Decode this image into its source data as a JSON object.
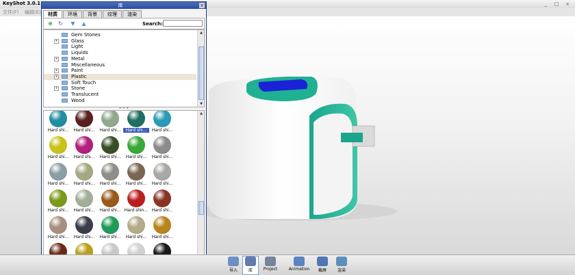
{
  "app": {
    "title": "KeyShot 3.0.1",
    "menu": [
      "文件(F)",
      "编辑(E)"
    ],
    "window_controls": [
      "_",
      "□",
      "×"
    ]
  },
  "library": {
    "title": "库",
    "tabs": [
      "材质",
      "环境",
      "背景",
      "纹理",
      "渲染"
    ],
    "active_tab": 0,
    "search_label": "Search:",
    "search_value": "",
    "toolbar_icons": [
      "add-material-icon",
      "refresh-icon",
      "move-down-icon",
      "move-up-icon"
    ],
    "tree": [
      {
        "label": "Gem Stones",
        "expandable": false
      },
      {
        "label": "Glass",
        "expandable": true
      },
      {
        "label": "Light",
        "expandable": false
      },
      {
        "label": "Liquids",
        "expandable": false
      },
      {
        "label": "Metal",
        "expandable": true
      },
      {
        "label": "Miscellaneous",
        "expandable": false
      },
      {
        "label": "Paint",
        "expandable": true
      },
      {
        "label": "Plastic",
        "expandable": true,
        "selected": true
      },
      {
        "label": "Soft Touch",
        "expandable": false
      },
      {
        "label": "Stone",
        "expandable": true
      },
      {
        "label": "Translucent",
        "expandable": false
      },
      {
        "label": "Wood",
        "expandable": false
      }
    ],
    "materials": [
      {
        "label": "Hard shi...",
        "color": "#1f8ea0"
      },
      {
        "label": "Hard shi...",
        "color": "#5a2020"
      },
      {
        "label": "Hard shi...",
        "color": "#8fa88e"
      },
      {
        "label": "Hard shi...",
        "color": "#1f6e62",
        "selected": true
      },
      {
        "label": "Hard shi...",
        "color": "#2a9ab6"
      },
      {
        "label": "Hard shi...",
        "color": "#c9c21c"
      },
      {
        "label": "Hard shi...",
        "color": "#b1207a"
      },
      {
        "label": "Hard shi...",
        "color": "#3a4e26"
      },
      {
        "label": "Hard shi...",
        "color": "#3aa83a"
      },
      {
        "label": "Hard shi...",
        "color": "#8c8c8c"
      },
      {
        "label": "Hard shi...",
        "color": "#8a9ea6"
      },
      {
        "label": "Hard shi...",
        "color": "#a6a882"
      },
      {
        "label": "Hard shi...",
        "color": "#8e8e8a"
      },
      {
        "label": "Hard shi...",
        "color": "#7a6652"
      },
      {
        "label": "Hard shi...",
        "color": "#a8a8a6"
      },
      {
        "label": "Hard shi...",
        "color": "#7a9a1a"
      },
      {
        "label": "Hard shi...",
        "color": "#a2ae98"
      },
      {
        "label": "Hard shi...",
        "color": "#9a5a1a"
      },
      {
        "label": "Hard shin...",
        "color": "#b82020"
      },
      {
        "label": "Hard shi...",
        "color": "#8a3424"
      },
      {
        "label": "Hard shi...",
        "color": "#a88e7e"
      },
      {
        "label": "Hard shi...",
        "color": "#3a3e48"
      },
      {
        "label": "Hard shi...",
        "color": "#1f9a5a"
      },
      {
        "label": "Hard shi...",
        "color": "#b2aa88"
      },
      {
        "label": "Hard shi...",
        "color": "#b8841e"
      },
      {
        "label": "",
        "color": "#6a2a14"
      },
      {
        "label": "",
        "color": "#b8a01e"
      },
      {
        "label": "",
        "color": "#c8c8c8"
      },
      {
        "label": "",
        "color": "#d0d0d0"
      },
      {
        "label": "",
        "color": "#1a1a1a"
      }
    ]
  },
  "bottom_toolbar": [
    {
      "label": "导入",
      "icon": "import-icon"
    },
    {
      "label": "库",
      "icon": "library-icon",
      "active": true
    },
    {
      "label": "Project",
      "icon": "project-icon"
    },
    {
      "label": "Animation",
      "icon": "animation-icon"
    },
    {
      "label": "截屏",
      "icon": "screenshot-icon"
    },
    {
      "label": "渲染",
      "icon": "render-icon"
    }
  ],
  "colors": {
    "accent": "#1fa890",
    "titlebar": "#2a4c9c"
  }
}
